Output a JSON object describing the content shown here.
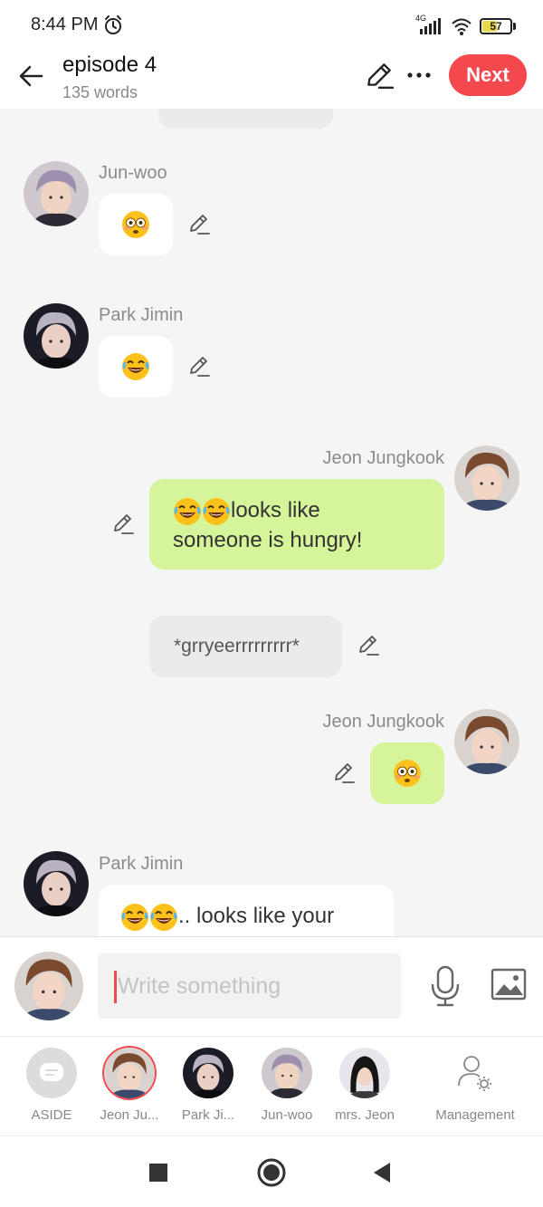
{
  "status_bar": {
    "time": "8:44 PM",
    "network": "4G",
    "battery": "57",
    "battery_level": 0.57
  },
  "header": {
    "title": "episode 4",
    "word_count": "135 words",
    "next_label": "Next"
  },
  "messages": [
    {
      "sender": "Jun-woo",
      "emoji": "flushed-face"
    },
    {
      "sender": "Park Jimin",
      "emoji": "tears-of-joy"
    },
    {
      "sender": "Jeon Jungkook",
      "line1": "looks like",
      "line2": "someone is hungry!"
    },
    {
      "text": "*grryeerrrrrrrrr*"
    },
    {
      "sender": "Jeon Jungkook",
      "emoji": "flushed-face"
    },
    {
      "sender": "Park Jimin",
      "text": ".. looks like your"
    }
  ],
  "composer": {
    "placeholder": "Write something"
  },
  "characters": [
    {
      "label": "ASIDE"
    },
    {
      "label": "Jeon Ju..."
    },
    {
      "label": "Park Ji..."
    },
    {
      "label": "Jun-woo"
    },
    {
      "label": "mrs. Jeon"
    },
    {
      "label": "Management"
    }
  ],
  "colors": {
    "accent": "#f2484e",
    "sent_bubble": "#d6f59a",
    "received_bubble": "#ffffff",
    "aside_bubble": "#ebebeb"
  }
}
